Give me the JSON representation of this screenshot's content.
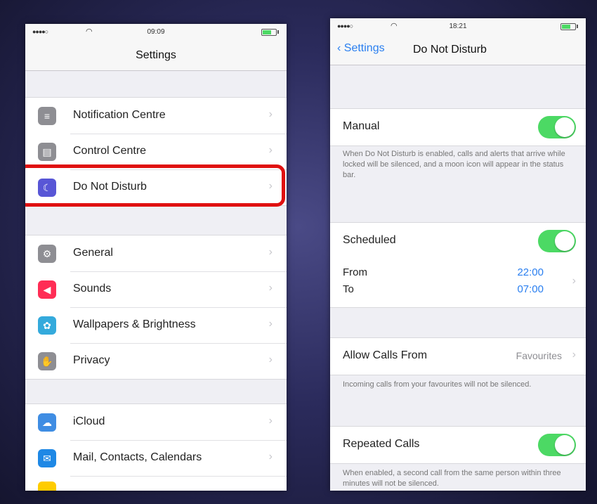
{
  "left_screen": {
    "status": {
      "signal": "●●●●○",
      "time": "09:09"
    },
    "title": "Settings",
    "group1": [
      {
        "label": "Notification Centre",
        "icon": "notification-centre-icon",
        "color": "#8e8e93",
        "glyph": "≡"
      },
      {
        "label": "Control Centre",
        "icon": "control-centre-icon",
        "color": "#8e8e93",
        "glyph": "▤"
      },
      {
        "label": "Do Not Disturb",
        "icon": "moon-icon",
        "color": "#5856d6",
        "glyph": "☾"
      }
    ],
    "group2": [
      {
        "label": "General",
        "icon": "gear-icon",
        "color": "#8e8e93",
        "glyph": "⚙"
      },
      {
        "label": "Sounds",
        "icon": "speaker-icon",
        "color": "#ff2d55",
        "glyph": "◀"
      },
      {
        "label": "Wallpapers & Brightness",
        "icon": "wallpaper-icon",
        "color": "#34aadc",
        "glyph": "✿"
      },
      {
        "label": "Privacy",
        "icon": "hand-icon",
        "color": "#8e8e93",
        "glyph": "✋"
      }
    ],
    "group3": [
      {
        "label": "iCloud",
        "icon": "cloud-icon",
        "color": "#3f8de3",
        "glyph": "☁"
      },
      {
        "label": "Mail, Contacts, Calendars",
        "icon": "mail-icon",
        "color": "#1e88e5",
        "glyph": "✉"
      }
    ]
  },
  "right_screen": {
    "status": {
      "signal": "●●●●○",
      "time": "18:21"
    },
    "back_label": "Settings",
    "title": "Do Not Disturb",
    "manual": {
      "label": "Manual",
      "on": true
    },
    "manual_note": "When Do Not Disturb is enabled, calls and alerts that arrive while locked will be silenced, and a moon icon will appear in the status bar.",
    "scheduled": {
      "label": "Scheduled",
      "on": true
    },
    "from_label": "From",
    "to_label": "To",
    "from_time": "22:00",
    "to_time": "07:00",
    "allow_calls": {
      "label": "Allow Calls From",
      "value": "Favourites"
    },
    "allow_note": "Incoming calls from your favourites will not be silenced.",
    "repeated": {
      "label": "Repeated Calls",
      "on": true
    },
    "repeated_note": "When enabled, a second call from the same person within three minutes will not be silenced."
  }
}
